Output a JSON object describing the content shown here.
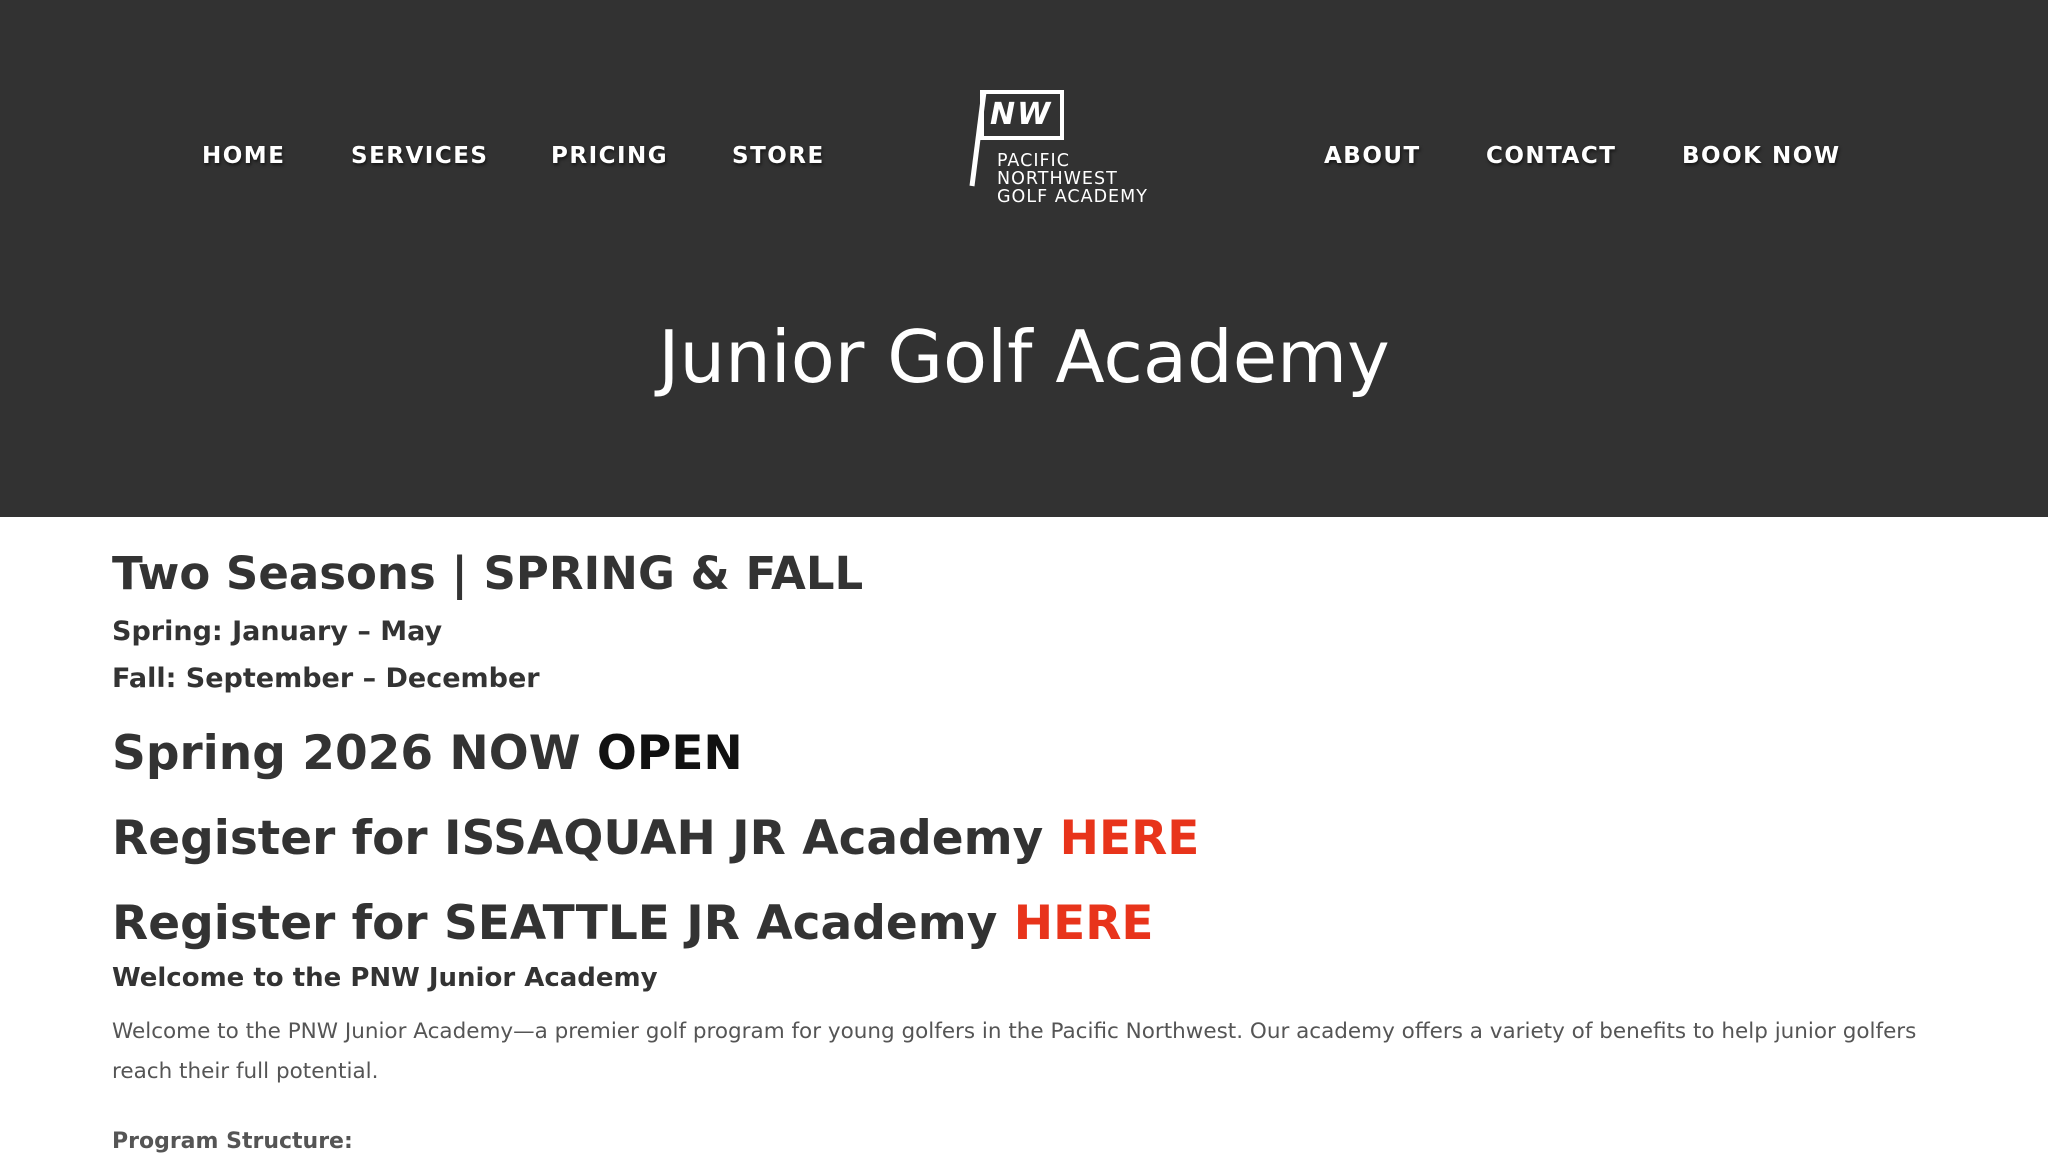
{
  "nav": {
    "left": [
      "HOME",
      "SERVICES",
      "PRICING",
      "STORE"
    ],
    "right": [
      "ABOUT",
      "CONTACT",
      "BOOK NOW"
    ]
  },
  "logo": {
    "mark": "NW",
    "lines": [
      "PACIFIC",
      "NORTHWEST",
      "GOLF ACADEMY"
    ]
  },
  "page_title": "Junior Golf Academy",
  "content": {
    "seasons_heading": "Two Seasons |  SPRING & FALL",
    "spring": "Spring: January – May",
    "fall": "Fall: September – December",
    "open_prefix": "Spring 2026 NOW ",
    "open_word": "OPEN",
    "issaquah_text": "Register for ISSAQUAH JR Academy ",
    "issaquah_link": "HERE",
    "seattle_text": "Register for SEATTLE JR Academy ",
    "seattle_link": "HERE",
    "welcome_heading": "Welcome to the PNW Junior Academy",
    "welcome_paragraph": "Welcome to the PNW Junior Academy—a premier golf program for young golfers in the Pacific Northwest. Our academy offers a variety of benefits to help junior golfers reach their full potential.",
    "program_structure": "Program Structure:"
  },
  "colors": {
    "header_bg": "#323232",
    "link_accent": "#e8341b",
    "heading_text": "#333333",
    "body_text": "#555555"
  }
}
